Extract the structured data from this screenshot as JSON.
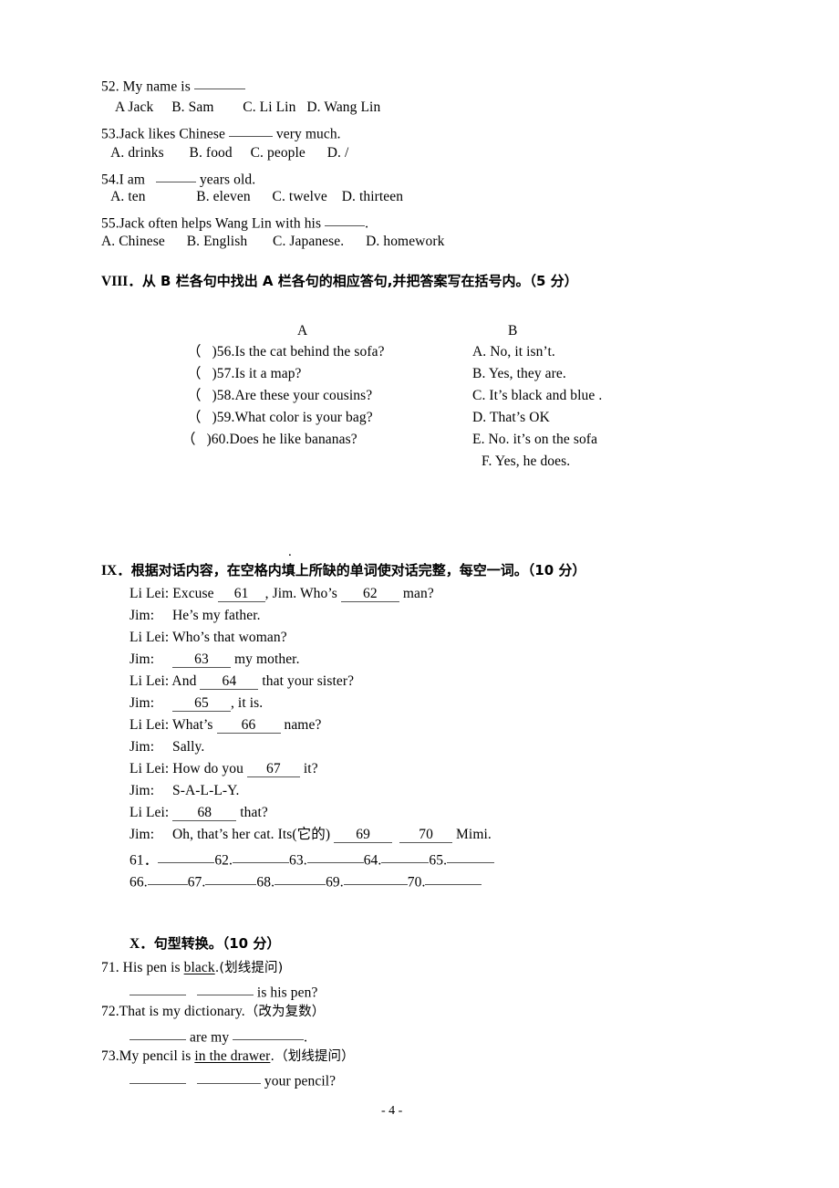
{
  "document": {
    "page_number_label": "- 4 -",
    "stray_dot": "."
  },
  "multiple_choice": {
    "questions": [
      {
        "stem_prefix": "52. My name is ",
        "options_line": "A Jack     B. Sam        C. Li Lin   D. Wang Lin"
      },
      {
        "stem_prefix": "53.Jack likes Chinese ",
        "stem_suffix": " very much.",
        "options_line": " A. drinks       B. food     C. people      D. /"
      },
      {
        "stem_prefix": "54.I am   ",
        "stem_suffix": " years old.",
        "options_line": " A. ten              B. eleven      C. twelve    D. thirteen"
      },
      {
        "stem_prefix": "55.Jack often helps Wang Lin with his ",
        "stem_suffix": ".",
        "options_line": "A. Chinese      B. English       C. Japanese.      D. homework"
      }
    ]
  },
  "section_viii": {
    "number": "VIII",
    "title_cn": "从 B 栏各句中找出 A 栏各句的相应答句,并把答案写在括号内。",
    "points": "（5 分）",
    "column_a_header": "A",
    "column_b_header": "B",
    "column_a": [
      "（   )56.Is the cat behind the sofa?",
      "（   )57.Is it a map?",
      "（   )58.Are these your cousins?",
      "（   )59.What color is your bag?",
      "（   )60.Does he like bananas?"
    ],
    "column_b": [
      "A. No, it isn’t.",
      "B. Yes, they are.",
      "C. It’s black and blue .",
      "D. That’s OK",
      "E. No. it’s on the sofa",
      "F. Yes, he does."
    ]
  },
  "section_ix": {
    "number": "IX",
    "title_cn": "根据对话内容，在空格内填上所缺的单词使对话完整，每空一词。",
    "points": "（10 分）",
    "dialogue": [
      {
        "speaker": "Li Lei:",
        "pre": " Excuse ",
        "n1": "61",
        "mid": ", Jim. Who’s ",
        "n2": "62",
        "post": " man?"
      },
      {
        "speaker": "Jim:",
        "pre": "     He’s my father."
      },
      {
        "speaker": "Li Lei:",
        "pre": " Who’s that woman?"
      },
      {
        "speaker": "Jim:",
        "pre": "     ",
        "n1": "63",
        "post": " my mother."
      },
      {
        "speaker": "Li Lei:",
        "pre": " And ",
        "n1": "64",
        "post": " that your sister?"
      },
      {
        "speaker": "Jim:",
        "pre": "     ",
        "n1": "65",
        "post": ", it is."
      },
      {
        "speaker": "Li Lei:",
        "pre": " What’s ",
        "n1": "66",
        "post": " name?"
      },
      {
        "speaker": "Jim:",
        "pre": "     Sally."
      },
      {
        "speaker": "Li Lei:",
        "pre": " How do you ",
        "n1": "67",
        "post": " it?"
      },
      {
        "speaker": "Jim:",
        "pre": "     S-A-L-L-Y."
      },
      {
        "speaker": "Li Lei:",
        "pre": " ",
        "n1": "68",
        "post": " that?"
      },
      {
        "speaker": "Jim:",
        "pre": "     Oh, that’s her cat. Its(它的) ",
        "n1": "69",
        "mid": "  ",
        "n2": "70",
        "post": " Mimi."
      }
    ],
    "answer_row_1": [
      "61．",
      "62.",
      "63.",
      "64.",
      "65."
    ],
    "answer_row_2": [
      "66.",
      "67.",
      "68.",
      "69.",
      "70."
    ]
  },
  "section_x": {
    "number": "X",
    "title_cn": "句型转换。",
    "points": "（10 分）",
    "items": [
      {
        "prompt_pre": "71. His pen is ",
        "prompt_underlined": "black",
        "prompt_post": ".(划线提问)",
        "answer_suffix": " is his pen?"
      },
      {
        "prompt_pre": "72.That is my dictionary.",
        "prompt_post": "（改为复数）",
        "answer_mid": " are my ",
        "answer_end": "."
      },
      {
        "prompt_pre": "73.My pencil is ",
        "prompt_underlined": "in the drawer",
        "prompt_post": ".（划线提问）",
        "answer_suffix": " your pencil?"
      }
    ]
  }
}
